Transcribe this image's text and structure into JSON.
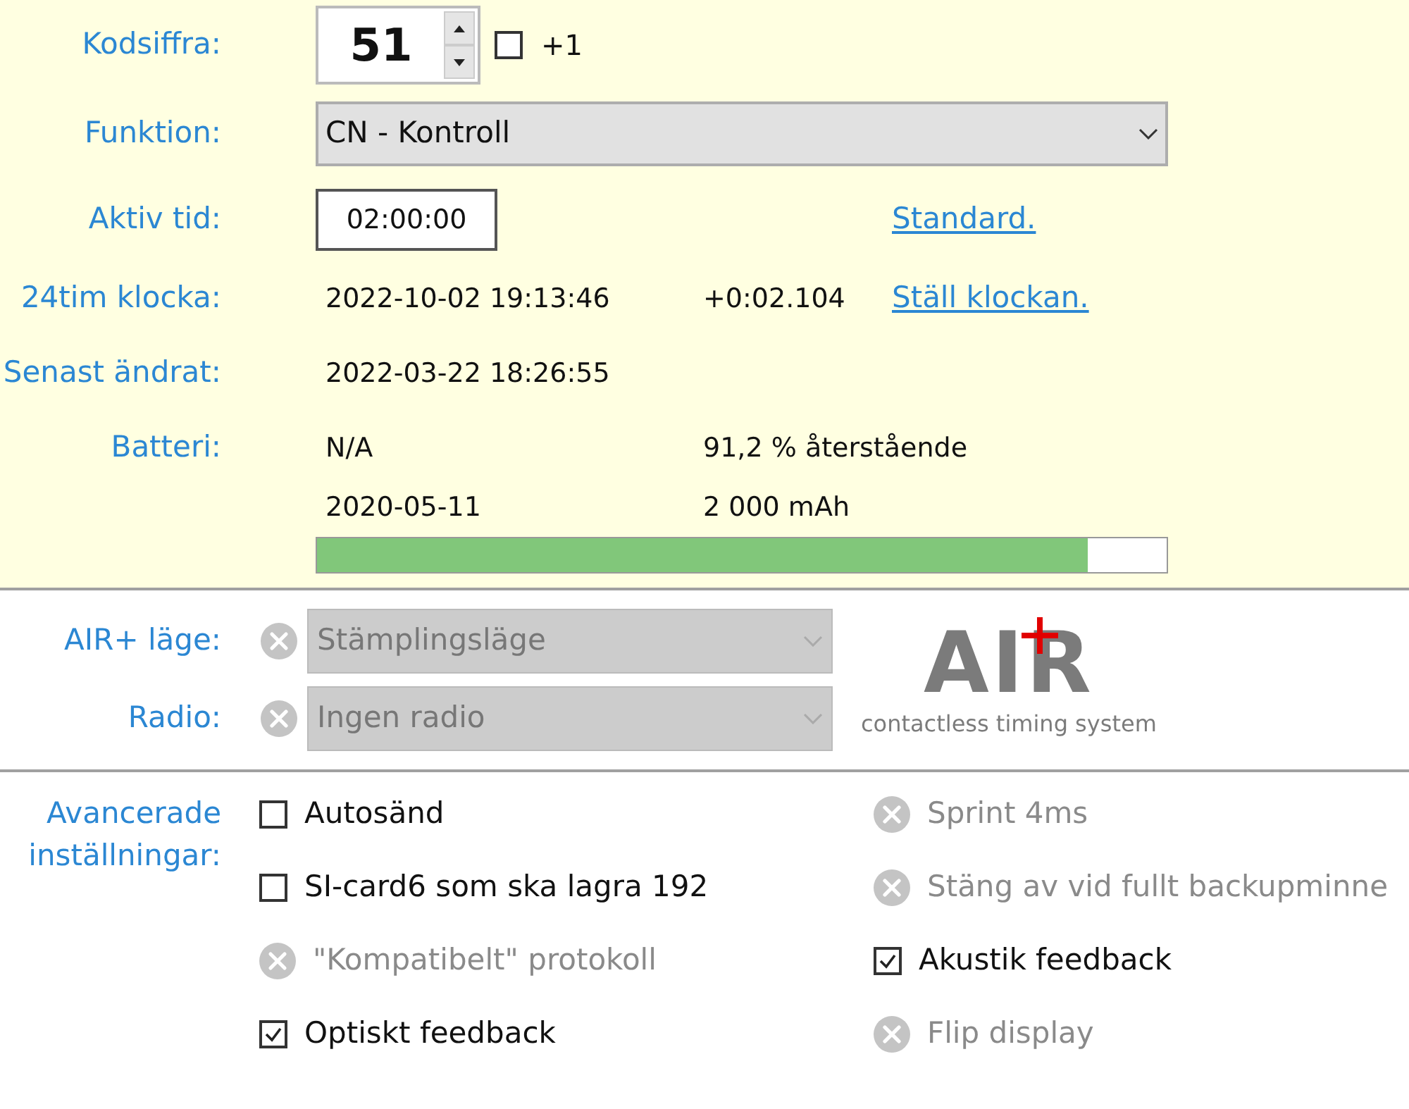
{
  "station": {
    "code_label": "Kodsiffra:",
    "code": "51",
    "plus_one": {
      "label": "+1",
      "checked": false
    },
    "function_label": "Funktion:",
    "function": "CN - Kontroll",
    "active_label": "Aktiv tid:",
    "active_time": "02:00:00",
    "standard_link": "Standard.",
    "clock_label": "24tim klocka:",
    "clock": "2022-10-02 19:13:46",
    "clock_offset": "+0:02.104",
    "set_clock_link": "Ställ klockan.",
    "changed_label": "Senast ändrat:",
    "changed": "2022-03-22 18:26:55",
    "battery_label": "Batteri:",
    "battery_voltage": "N/A",
    "battery_remaining": "91,2 % återstående",
    "battery_date": "2020-05-11",
    "battery_capacity": "2 000 mAh",
    "battery": {
      "level": 0.907
    }
  },
  "air": {
    "mode_label": "AIR+ läge:",
    "mode": "Stämplingsläge",
    "radio_label": "Radio:",
    "radio": "Ingen radio",
    "logo_word": "AIR",
    "logo_tagline": "contactless timing system"
  },
  "advanced": {
    "label_lines": [
      "Avancerade",
      "inställningar:"
    ],
    "options": [
      {
        "label": "Autosänd",
        "kind": "checkbox",
        "checked": false
      },
      {
        "label": "Sprint 4ms",
        "kind": "unavailable"
      },
      {
        "label": "SI-card6 som ska lagra 192",
        "kind": "checkbox",
        "checked": false
      },
      {
        "label": "Stäng av vid fullt backupminne",
        "kind": "unavailable"
      },
      {
        "label": "\"Kompatibelt\" protokoll",
        "kind": "unavailable"
      },
      {
        "label": "Akustik feedback",
        "kind": "checkbox",
        "checked": true
      },
      {
        "label": "Optiskt feedback",
        "kind": "checkbox",
        "checked": true
      },
      {
        "label": "Flip display",
        "kind": "unavailable"
      }
    ]
  }
}
